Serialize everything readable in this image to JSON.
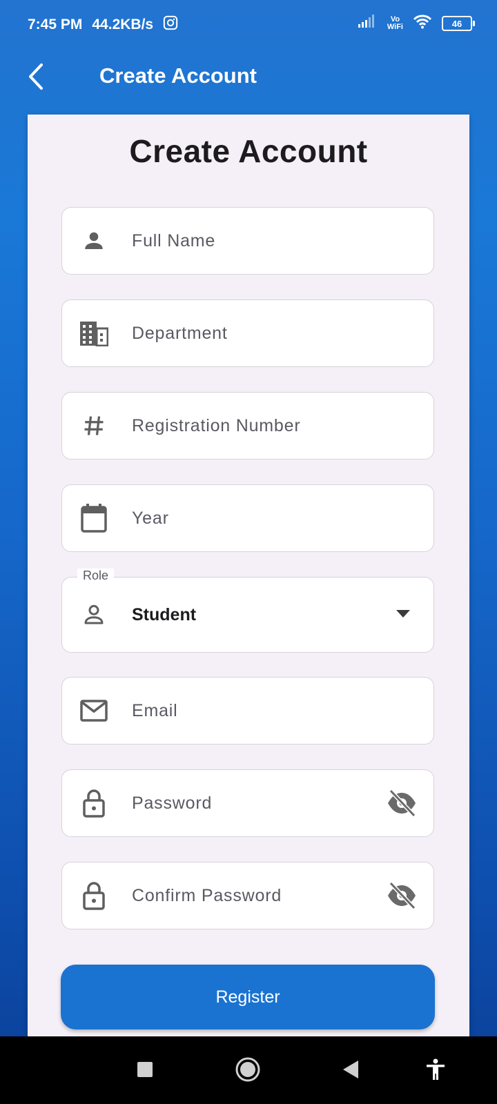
{
  "status_bar": {
    "time": "7:45 PM",
    "speed": "44.2KB/s",
    "notif_icon": "instagram-icon",
    "vowifi_top": "Vo",
    "vowifi_bottom": "WiFi",
    "battery": "46"
  },
  "app_bar": {
    "title": "Create Account",
    "back_icon": "chevron-left-icon"
  },
  "form": {
    "heading": "Create Account",
    "full_name_placeholder": "Full Name",
    "department_placeholder": "Department",
    "registration_placeholder": "Registration Number",
    "year_placeholder": "Year",
    "role_label": "Role",
    "role_value": "Student",
    "email_placeholder": "Email",
    "password_placeholder": "Password",
    "confirm_password_placeholder": "Confirm Password",
    "register_label": "Register"
  },
  "colors": {
    "primary": "#1a73d1",
    "card_bg": "#f5f0f7",
    "icon_gray": "#5f5f5f"
  }
}
